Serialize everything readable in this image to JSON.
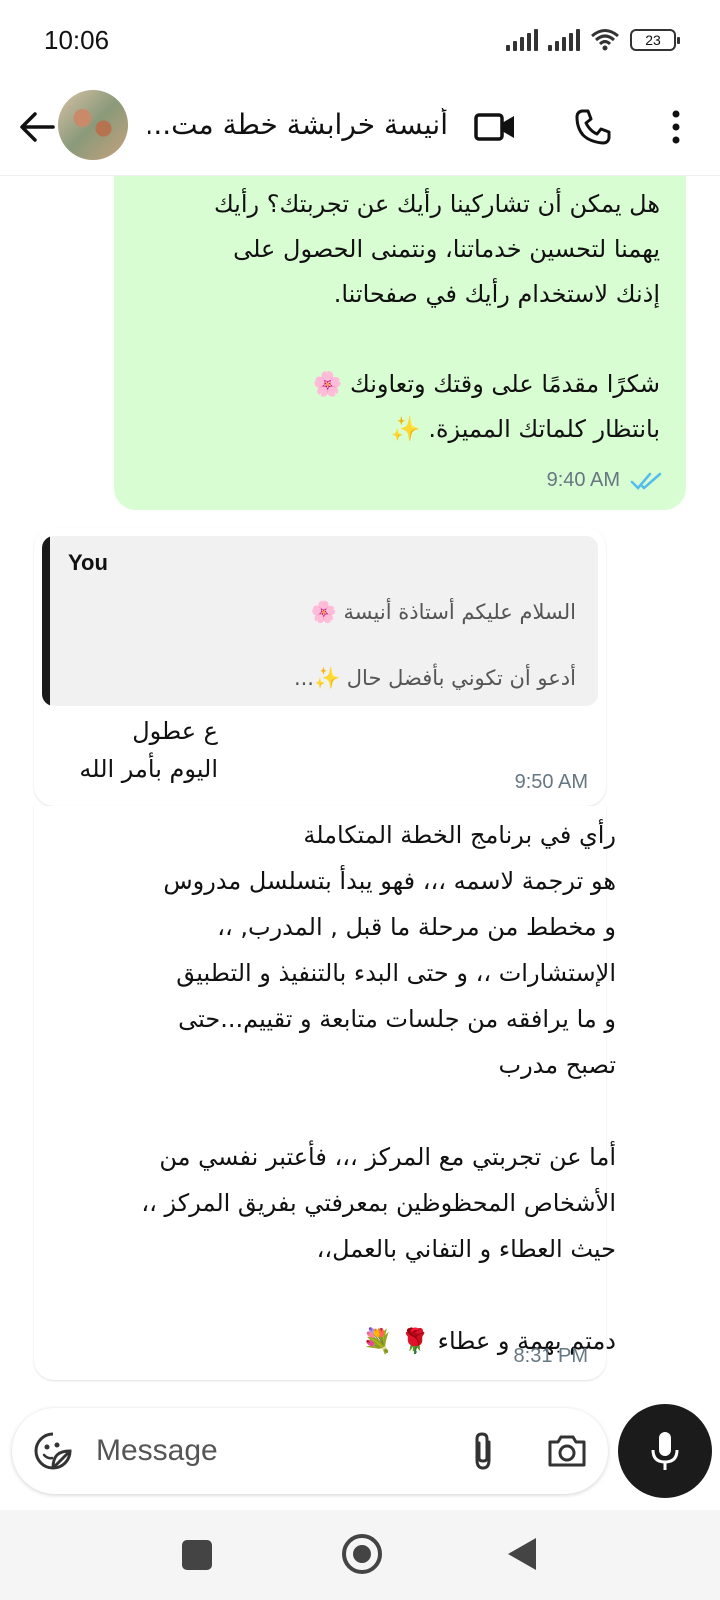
{
  "status_bar": {
    "time": "10:06",
    "battery": "23"
  },
  "header": {
    "contact_name": "أنيسة خرابشة خطة مت..."
  },
  "messages": [
    {
      "direction": "outgoing",
      "text": "هل يمكن أن تشاركينا رأيك عن تجربتك؟ رأيك\nيهمنا لتحسين خدماتنا، ونتمنى الحصول على\nإذنك لاستخدام رأيك في صفحاتنا.\n\nشكرًا مقدمًا على وقتك وتعاونك 🌸\nبانتظار كلماتك المميزة. ✨",
      "time": "9:40 AM",
      "status": "read"
    },
    {
      "direction": "incoming",
      "quote": {
        "author": "You",
        "line1": "السلام عليكم أستاذة أنيسة 🌸",
        "line2": "أدعو أن تكوني بأفضل حال ✨..."
      },
      "text": "ع عطول\nاليوم بأمر الله",
      "time": "9:50 AM"
    },
    {
      "direction": "incoming",
      "text": "رأي في برنامج الخطة المتكاملة\nهو ترجمة لاسمه ،،، فهو يبدأ بتسلسل مدروس\nو مخطط من مرحلة ما قبل , المدرب, ،،\nالإستشارات ،، و حتى البدء بالتنفيذ و التطبيق\nو ما يرافقه من جلسات متابعة و تقييم...حتى\nتصبح مدرب\n\nأما عن تجربتي مع المركز ،،، فأعتبر نفسي من\nالأشخاص المحظوظين بمعرفتي بفريق المركز ،،\nحيث العطاء و التفاني  بالعمل،،\n\nدمتم بهمة و عطاء 🌹 💐",
      "time": "8:31 PM"
    }
  ],
  "composer": {
    "placeholder": "Message"
  },
  "icons": {
    "back": "arrow-left-icon",
    "video": "video-call-icon",
    "call": "phone-icon",
    "menu": "more-vert-icon",
    "sticker": "sticker-icon",
    "attach": "paperclip-icon",
    "camera": "camera-icon",
    "mic": "microphone-icon"
  },
  "colors": {
    "outgoing_bubble": "#d9fdd3",
    "read_ticks": "#53bdeb",
    "mic_button": "#1b1b1b"
  }
}
